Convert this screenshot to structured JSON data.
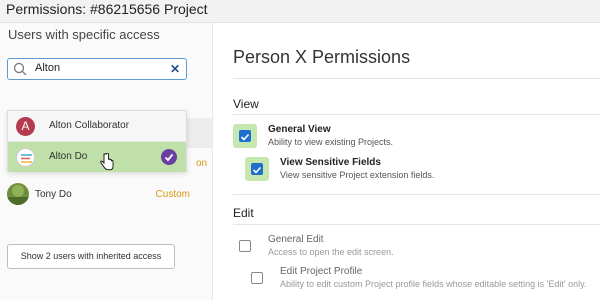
{
  "window": {
    "title": "Permissions: #86215656 Project"
  },
  "left": {
    "heading": "Users with specific access",
    "search": {
      "value": "Alton"
    },
    "dropdown": [
      {
        "label": "Alton Collaborator",
        "avatar": "A"
      },
      {
        "label": "Alton Do",
        "selected": true
      }
    ],
    "users": [
      {
        "name": "Tony Do",
        "tag": "Custom"
      }
    ],
    "partial_tag": "on",
    "show_inherited_button": "Show 2 users with inherited access"
  },
  "right": {
    "title": "Person X Permissions",
    "sections": [
      {
        "label": "View",
        "permissions": [
          {
            "title": "General View",
            "desc": "Ability to view existing Projects.",
            "checked": true
          },
          {
            "title": "View Sensitive Fields",
            "desc": "View sensitive Project extension fields.",
            "checked": true
          }
        ]
      },
      {
        "label": "Edit",
        "permissions": [
          {
            "title": "General Edit",
            "desc": "Access to open the edit screen.",
            "checked": false
          },
          {
            "title": "Edit Project Profile",
            "desc": "Ability to edit custom Project profile fields whose editable setting is 'Edit' only.",
            "checked": false
          }
        ]
      }
    ]
  },
  "colors": {
    "accent": "#1f6fd1",
    "selected_row": "#bfe0a8",
    "custom_tag": "#d99b10",
    "selected_check": "#6b3fa0"
  }
}
